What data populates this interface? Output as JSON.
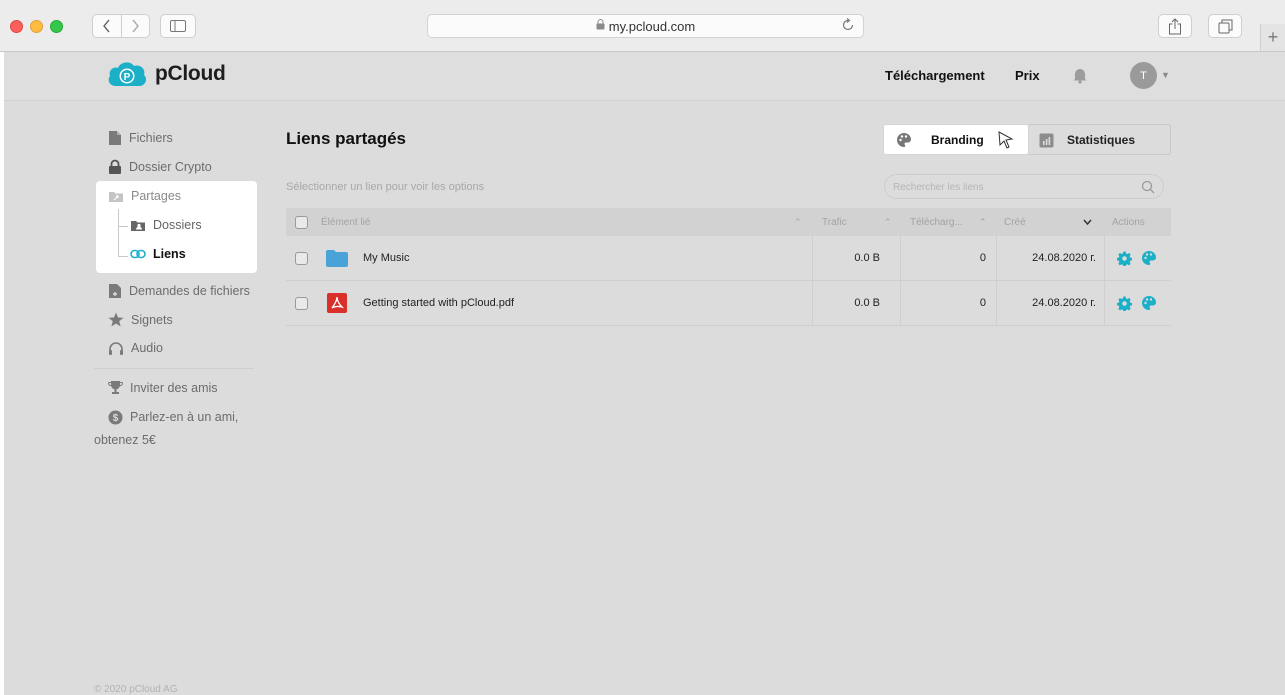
{
  "browser": {
    "url": "my.pcloud.com"
  },
  "header": {
    "brand": "pCloud",
    "download_label": "Téléchargement",
    "price_label": "Prix",
    "avatar_initial": "T"
  },
  "sidebar": {
    "files": "Fichiers",
    "crypto": "Dossier Crypto",
    "shares": "Partages",
    "dossiers": "Dossiers",
    "liens": "Liens",
    "requests": "Demandes de fichiers",
    "bookmarks": "Signets",
    "audio": "Audio",
    "invite": "Inviter des amis",
    "referral_line1": "Parlez-en à un ami,",
    "referral_line2": "obtenez 5€",
    "copyright": "© 2020 pCloud AG"
  },
  "main": {
    "title": "Liens partagés",
    "branding_label": "Branding",
    "stats_label": "Statistiques",
    "hint": "Sélectionner un lien pour voir les options",
    "search_placeholder": "Rechercher les liens"
  },
  "table": {
    "columns": {
      "item": "Élément lié",
      "traffic": "Trafic",
      "downloads": "Télécharg...",
      "created": "Créé",
      "actions": "Actions"
    },
    "rows": [
      {
        "name": "My Music",
        "type": "folder",
        "traffic": "0.0 B",
        "downloads": "0",
        "created": "24.08.2020 г."
      },
      {
        "name": "Getting started with pCloud.pdf",
        "type": "pdf",
        "traffic": "0.0 B",
        "downloads": "0",
        "created": "24.08.2020 г."
      }
    ]
  },
  "colors": {
    "accent": "#1bb0c8",
    "folder": "#4aa3d8",
    "pdf": "#d9302c"
  }
}
